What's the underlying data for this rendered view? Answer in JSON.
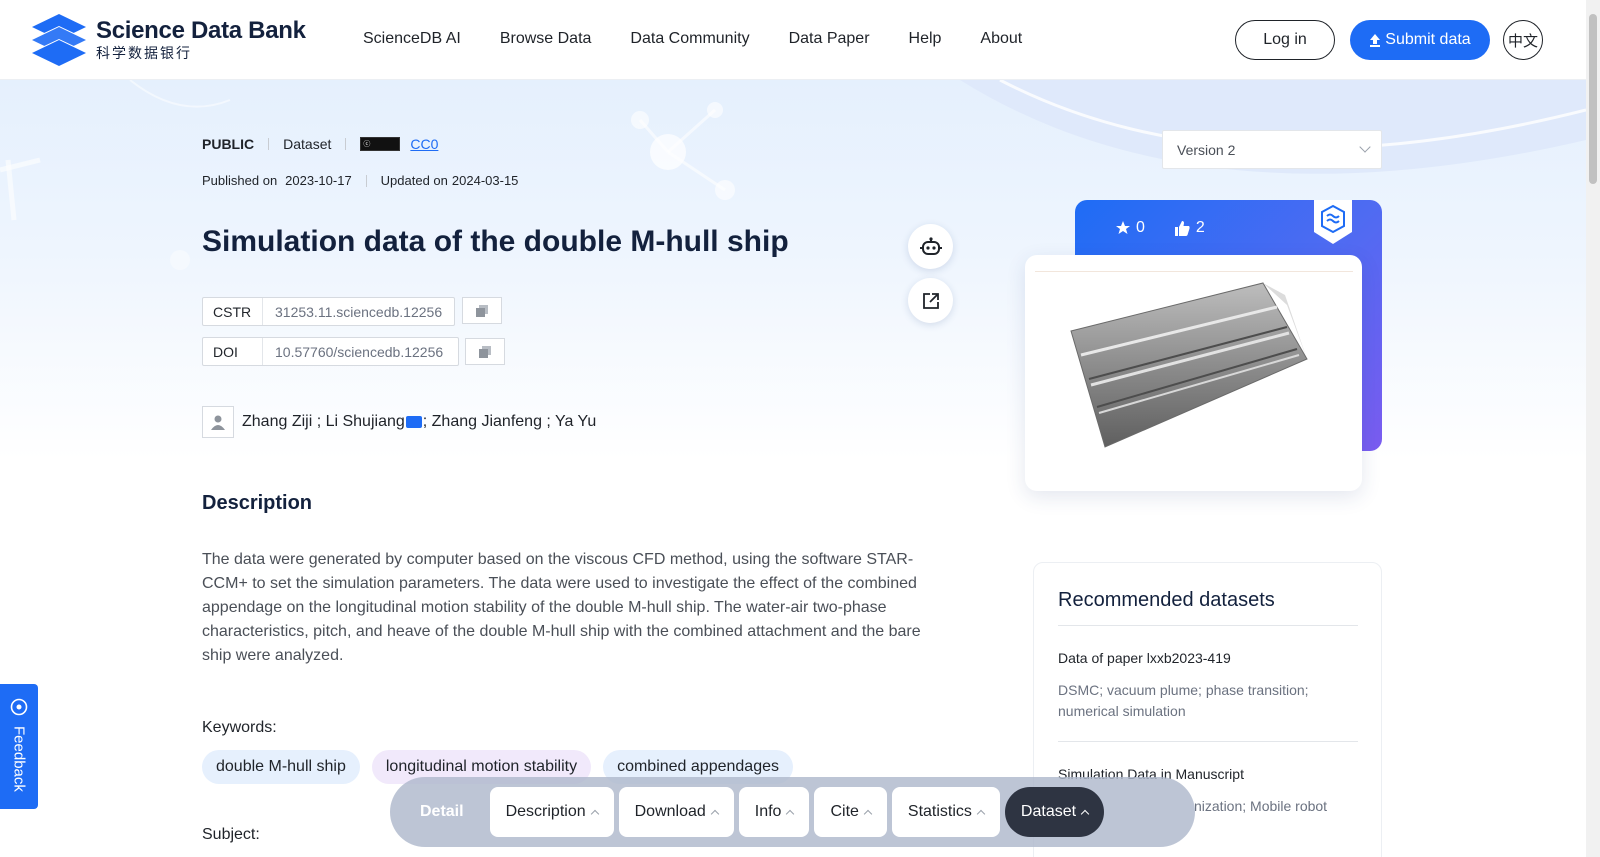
{
  "header": {
    "logo_en": "Science Data Bank",
    "logo_cn": "科学数据银行",
    "nav": [
      "ScienceDB AI",
      "Browse Data",
      "Data Community",
      "Data Paper",
      "Help",
      "About"
    ],
    "login": "Log in",
    "submit": "Submit data",
    "lang": "中文"
  },
  "dataset": {
    "visibility": "PUBLIC",
    "type": "Dataset",
    "license": "CC0",
    "published_label": "Published on",
    "published": "2023-10-17",
    "updated_label": "Updated on",
    "updated": "2024-03-15",
    "title": "Simulation data of the double M-hull ship",
    "cstr_label": "CSTR",
    "cstr": "31253.11.sciencedb.12256",
    "doi_label": "DOI",
    "doi": "10.57760/sciencedb.12256",
    "authors_a": "Zhang Ziji ; Li Shujiang",
    "authors_b": "; Zhang Jianfeng ; Ya Yu",
    "description_title": "Description",
    "description": "The data were generated by computer based on the viscous CFD method, using the software STAR-CCM+ to set the simulation parameters. The data were used to investigate the effect of the combined appendage on the longitudinal motion stability of the double M-hull ship. The water-air two-phase characteristics, pitch, and heave of the double M-hull ship with the combined attachment and the bare ship were analyzed.",
    "keywords_label": "Keywords:",
    "keywords": [
      "double M-hull ship",
      "longitudinal motion stability",
      "combined appendages"
    ],
    "subject_label": "Subject:"
  },
  "sidebar": {
    "version": "Version 2",
    "stars": "0",
    "likes": "2",
    "recommended_title": "Recommended datasets",
    "recommended": [
      {
        "name": "Data of paper lxxb2023-419",
        "keywords": "DSMC; vacuum plume; phase transition; numerical simulation"
      },
      {
        "name": "Simulation Data in Manuscript",
        "keywords": "nization; Mobile robot"
      }
    ]
  },
  "feedback": "Feedback",
  "tabbar": {
    "detail": "Detail",
    "tabs": [
      "Description",
      "Download",
      "Info",
      "Cite",
      "Statistics",
      "Dataset"
    ]
  },
  "colors": {
    "accent": "#1e6cf5",
    "dark": "#13213d",
    "tab_active": "#2e3442"
  }
}
